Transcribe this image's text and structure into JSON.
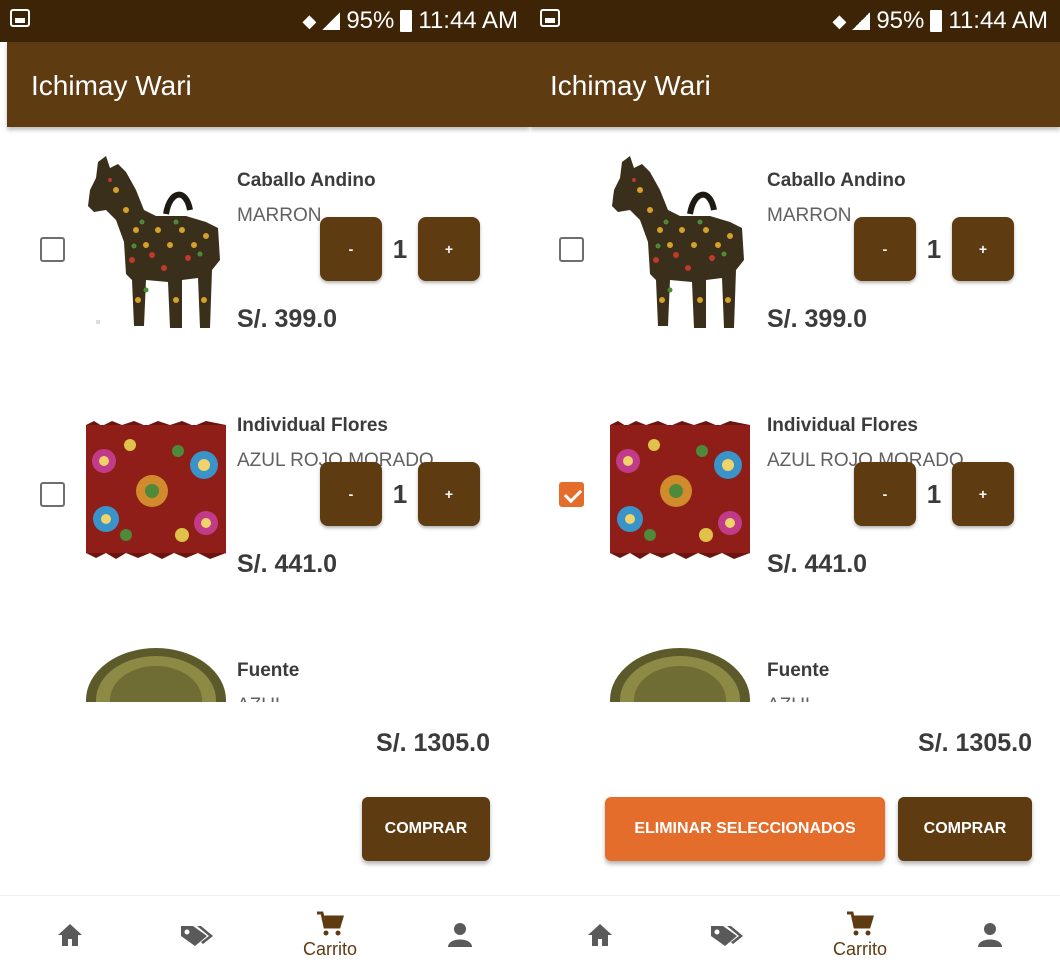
{
  "statusbar": {
    "battery": "95%",
    "time": "11:44 AM"
  },
  "app": {
    "title": "Ichimay Wari"
  },
  "cart_items": [
    {
      "name": "Caballo Andino",
      "color": "MARRON",
      "quantity": "1",
      "price": "S/. 399.0",
      "minus": "-",
      "plus": "+"
    },
    {
      "name": "Individual Flores",
      "color": "AZUL ROJO MORADO",
      "quantity": "1",
      "price": "S/. 441.0",
      "minus": "-",
      "plus": "+"
    },
    {
      "name": "Fuente",
      "color": "AZUL"
    }
  ],
  "left_screen": {
    "selected": [
      false,
      false,
      false
    ]
  },
  "right_screen": {
    "selected": [
      false,
      true,
      false
    ]
  },
  "total": "S/. 1305.0",
  "buttons": {
    "comprar": "COMPRAR",
    "eliminar": "ELIMINAR SELECCIONADOS"
  },
  "nav": {
    "items": [
      {
        "icon": "home-icon"
      },
      {
        "icon": "tag-icon"
      },
      {
        "icon": "cart-icon",
        "label": "Carrito",
        "active": true
      },
      {
        "icon": "person-icon"
      }
    ]
  },
  "colors": {
    "primary": "#5f3b12",
    "statusbar": "#3d2406",
    "accent": "#e56d2b",
    "text": "#3b3b3b"
  }
}
